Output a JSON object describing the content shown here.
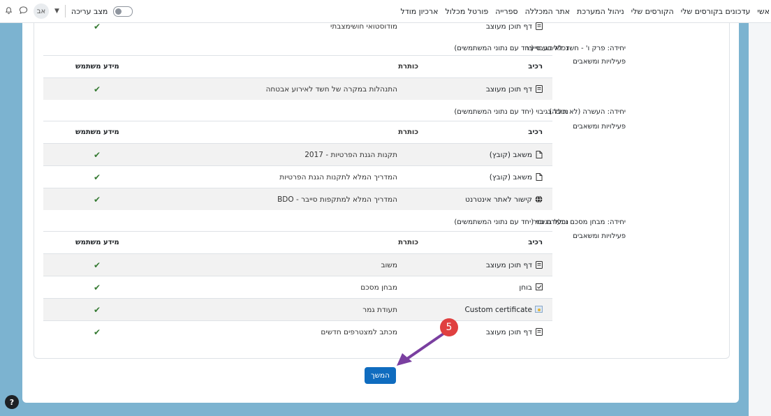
{
  "nav": {
    "links": [
      "אשי",
      "עדכונים בקורסים שלי",
      "הקורסים שלי",
      "ניהול המערכת",
      "אתר המכללה",
      "ספרייה",
      "פורטל מכלול",
      "ארכיון מודל"
    ],
    "edit_mode": "מצב עריכה",
    "avatar": "אב"
  },
  "top_partial": {
    "component": "דף תוכן מעוצב",
    "title": "מודוסטואי חושימצבתי"
  },
  "headers": {
    "component": "רכיב",
    "title": "כותרת",
    "user_info": "מידע משתמש"
  },
  "backup_text": "נכלל בגיבוי (יחד עם נתוני המשתמשים)",
  "units": [
    {
      "title": "יחידה: פרק ו' - חשד לאירוע סייבר",
      "subtitle": "פעילויות ומשאבים",
      "rows": [
        {
          "component": "דף תוכן מעוצב",
          "icon": "page-icon",
          "title": "התנהלות במקרה של חשד לאירוע אבטחה",
          "check": "✔"
        }
      ]
    },
    {
      "title": "יחידה: העשרה (לא חובה)",
      "subtitle": "פעילויות ומשאבים",
      "rows": [
        {
          "component": "משאב (קובץ)",
          "icon": "file-icon",
          "title": "תקנות הגנת הפרטיות - 2017",
          "check": "✔"
        },
        {
          "component": "משאב (קובץ)",
          "icon": "file-icon",
          "title": "המדריך המלא לתקנות הגנת הפרטיות",
          "check": "✔"
        },
        {
          "component": "קישור לאתר אינטרנט",
          "icon": "globe-icon",
          "title": "המדריך המלא למתקפות סייבר - BDO",
          "check": "✔"
        }
      ]
    },
    {
      "title": "יחידה: מבחן מסכם ותעודת גמר",
      "subtitle": "פעילויות ומשאבים",
      "rows": [
        {
          "component": "דף תוכן מעוצב",
          "icon": "page-icon",
          "title": "משוב",
          "check": "✔"
        },
        {
          "component": "בוחן",
          "icon": "quiz-icon",
          "title": "מבחן מסכם",
          "check": "✔"
        },
        {
          "component": "Custom certificate",
          "icon": "certificate-icon",
          "title": "תעודת גמר",
          "check": "✔"
        },
        {
          "component": "דף תוכן מעוצב",
          "icon": "page-icon",
          "title": "מכתב למצטרפים חדשים",
          "check": "✔"
        }
      ]
    }
  ],
  "continue_label": "המשך",
  "callout_number": "5",
  "help_label": "?"
}
